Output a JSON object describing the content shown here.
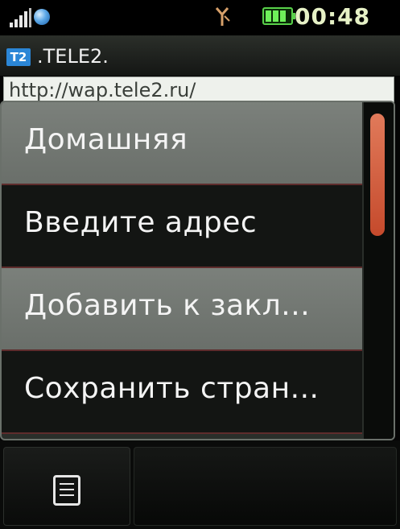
{
  "status_bar": {
    "time": "00:48",
    "icons": [
      "signal-icon",
      "globe-icon",
      "antenna-icon",
      "battery-icon"
    ],
    "battery_color": "#59d04a"
  },
  "browser": {
    "logo_text": "T2",
    "site_title": ".TELE2.",
    "url": "http://wap.tele2.ru/"
  },
  "menu": {
    "items": [
      {
        "label": "Домашняя"
      },
      {
        "label": "Введите адрес"
      },
      {
        "label": "Добавить к закл..."
      },
      {
        "label": "Сохранить стран..."
      }
    ],
    "scroll_thumb_color": "#c54a2c"
  },
  "softkeys": {
    "left_icon": "menu-icon"
  }
}
